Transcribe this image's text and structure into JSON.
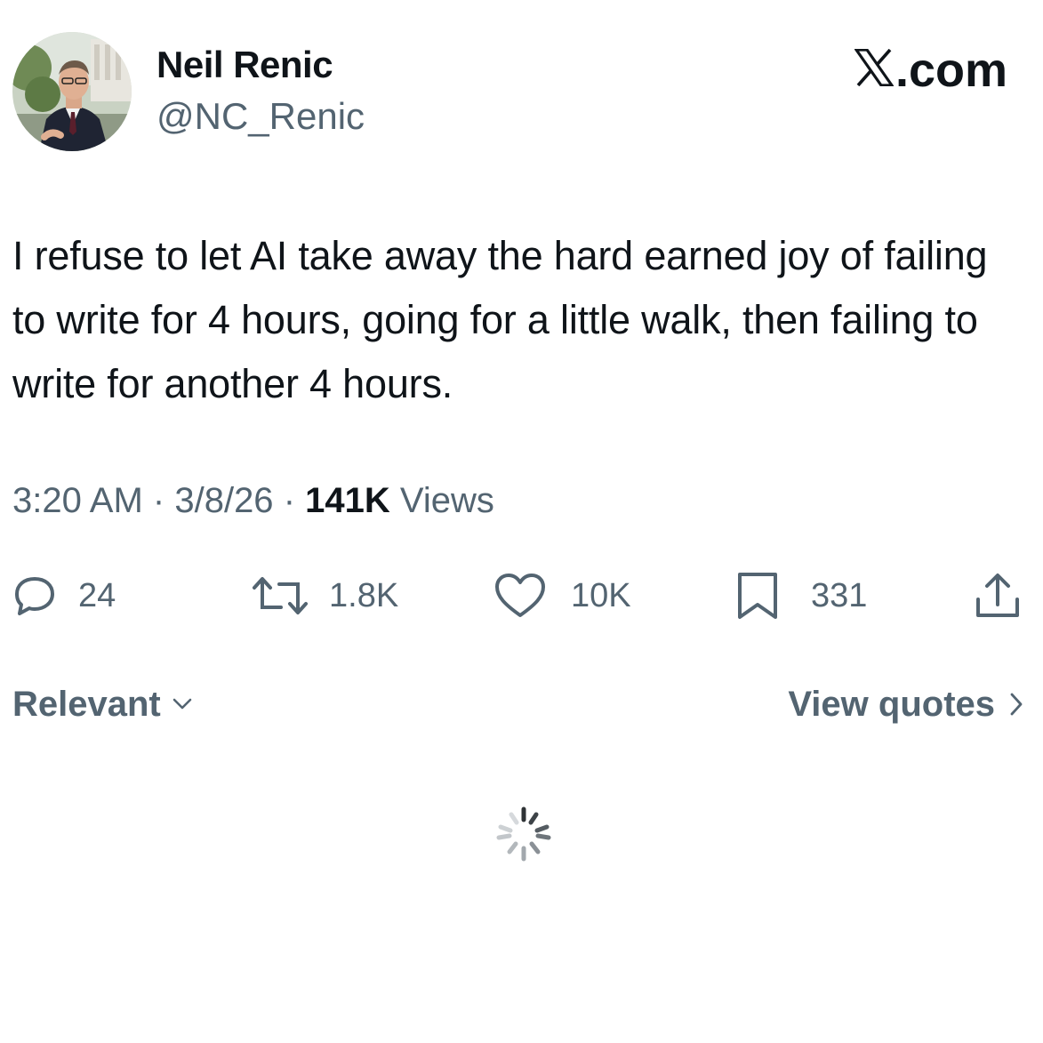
{
  "header": {
    "display_name": "Neil Renic",
    "handle": "@NC_Renic",
    "site_label": ".com",
    "site_logo_icon": "x-logo-icon"
  },
  "tweet": {
    "text": "I refuse to let AI take away the hard earned joy of failing to write for 4 hours, going for a little walk, then failing to write for another 4 hours.",
    "time": "3:20 AM",
    "date": "3/8/26",
    "separator": "·",
    "views_count": "141K",
    "views_label": "Views"
  },
  "actions": {
    "replies": "24",
    "reposts": "1.8K",
    "likes": "10K",
    "bookmarks": "331"
  },
  "filters": {
    "sort_label": "Relevant",
    "view_quotes_label": "View quotes"
  },
  "colors": {
    "text_primary": "#0f1419",
    "text_secondary": "#536471",
    "background": "#ffffff"
  },
  "icons": {
    "reply": "speech-bubble-icon",
    "repost": "repost-arrows-icon",
    "like": "heart-icon",
    "bookmark": "bookmark-icon",
    "share": "share-upload-icon",
    "sort": "chevron-down-icon",
    "quotes": "chevron-right-icon",
    "loading": "loading-spinner-icon"
  }
}
